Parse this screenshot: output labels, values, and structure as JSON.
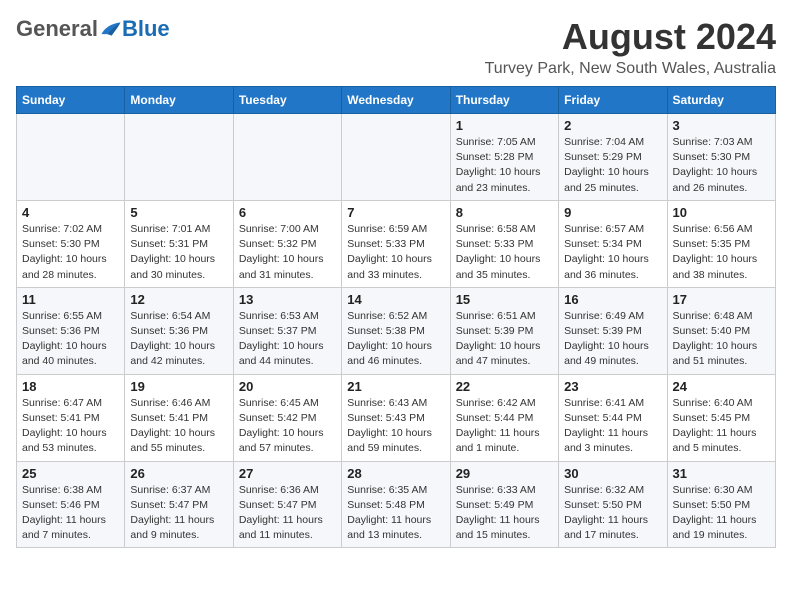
{
  "logo": {
    "general": "General",
    "blue": "Blue"
  },
  "title": "August 2024",
  "subtitle": "Turvey Park, New South Wales, Australia",
  "days_of_week": [
    "Sunday",
    "Monday",
    "Tuesday",
    "Wednesday",
    "Thursday",
    "Friday",
    "Saturday"
  ],
  "weeks": [
    [
      {
        "day": "",
        "info": ""
      },
      {
        "day": "",
        "info": ""
      },
      {
        "day": "",
        "info": ""
      },
      {
        "day": "",
        "info": ""
      },
      {
        "day": "1",
        "info": "Sunrise: 7:05 AM\nSunset: 5:28 PM\nDaylight: 10 hours\nand 23 minutes."
      },
      {
        "day": "2",
        "info": "Sunrise: 7:04 AM\nSunset: 5:29 PM\nDaylight: 10 hours\nand 25 minutes."
      },
      {
        "day": "3",
        "info": "Sunrise: 7:03 AM\nSunset: 5:30 PM\nDaylight: 10 hours\nand 26 minutes."
      }
    ],
    [
      {
        "day": "4",
        "info": "Sunrise: 7:02 AM\nSunset: 5:30 PM\nDaylight: 10 hours\nand 28 minutes."
      },
      {
        "day": "5",
        "info": "Sunrise: 7:01 AM\nSunset: 5:31 PM\nDaylight: 10 hours\nand 30 minutes."
      },
      {
        "day": "6",
        "info": "Sunrise: 7:00 AM\nSunset: 5:32 PM\nDaylight: 10 hours\nand 31 minutes."
      },
      {
        "day": "7",
        "info": "Sunrise: 6:59 AM\nSunset: 5:33 PM\nDaylight: 10 hours\nand 33 minutes."
      },
      {
        "day": "8",
        "info": "Sunrise: 6:58 AM\nSunset: 5:33 PM\nDaylight: 10 hours\nand 35 minutes."
      },
      {
        "day": "9",
        "info": "Sunrise: 6:57 AM\nSunset: 5:34 PM\nDaylight: 10 hours\nand 36 minutes."
      },
      {
        "day": "10",
        "info": "Sunrise: 6:56 AM\nSunset: 5:35 PM\nDaylight: 10 hours\nand 38 minutes."
      }
    ],
    [
      {
        "day": "11",
        "info": "Sunrise: 6:55 AM\nSunset: 5:36 PM\nDaylight: 10 hours\nand 40 minutes."
      },
      {
        "day": "12",
        "info": "Sunrise: 6:54 AM\nSunset: 5:36 PM\nDaylight: 10 hours\nand 42 minutes."
      },
      {
        "day": "13",
        "info": "Sunrise: 6:53 AM\nSunset: 5:37 PM\nDaylight: 10 hours\nand 44 minutes."
      },
      {
        "day": "14",
        "info": "Sunrise: 6:52 AM\nSunset: 5:38 PM\nDaylight: 10 hours\nand 46 minutes."
      },
      {
        "day": "15",
        "info": "Sunrise: 6:51 AM\nSunset: 5:39 PM\nDaylight: 10 hours\nand 47 minutes."
      },
      {
        "day": "16",
        "info": "Sunrise: 6:49 AM\nSunset: 5:39 PM\nDaylight: 10 hours\nand 49 minutes."
      },
      {
        "day": "17",
        "info": "Sunrise: 6:48 AM\nSunset: 5:40 PM\nDaylight: 10 hours\nand 51 minutes."
      }
    ],
    [
      {
        "day": "18",
        "info": "Sunrise: 6:47 AM\nSunset: 5:41 PM\nDaylight: 10 hours\nand 53 minutes."
      },
      {
        "day": "19",
        "info": "Sunrise: 6:46 AM\nSunset: 5:41 PM\nDaylight: 10 hours\nand 55 minutes."
      },
      {
        "day": "20",
        "info": "Sunrise: 6:45 AM\nSunset: 5:42 PM\nDaylight: 10 hours\nand 57 minutes."
      },
      {
        "day": "21",
        "info": "Sunrise: 6:43 AM\nSunset: 5:43 PM\nDaylight: 10 hours\nand 59 minutes."
      },
      {
        "day": "22",
        "info": "Sunrise: 6:42 AM\nSunset: 5:44 PM\nDaylight: 11 hours\nand 1 minute."
      },
      {
        "day": "23",
        "info": "Sunrise: 6:41 AM\nSunset: 5:44 PM\nDaylight: 11 hours\nand 3 minutes."
      },
      {
        "day": "24",
        "info": "Sunrise: 6:40 AM\nSunset: 5:45 PM\nDaylight: 11 hours\nand 5 minutes."
      }
    ],
    [
      {
        "day": "25",
        "info": "Sunrise: 6:38 AM\nSunset: 5:46 PM\nDaylight: 11 hours\nand 7 minutes."
      },
      {
        "day": "26",
        "info": "Sunrise: 6:37 AM\nSunset: 5:47 PM\nDaylight: 11 hours\nand 9 minutes."
      },
      {
        "day": "27",
        "info": "Sunrise: 6:36 AM\nSunset: 5:47 PM\nDaylight: 11 hours\nand 11 minutes."
      },
      {
        "day": "28",
        "info": "Sunrise: 6:35 AM\nSunset: 5:48 PM\nDaylight: 11 hours\nand 13 minutes."
      },
      {
        "day": "29",
        "info": "Sunrise: 6:33 AM\nSunset: 5:49 PM\nDaylight: 11 hours\nand 15 minutes."
      },
      {
        "day": "30",
        "info": "Sunrise: 6:32 AM\nSunset: 5:50 PM\nDaylight: 11 hours\nand 17 minutes."
      },
      {
        "day": "31",
        "info": "Sunrise: 6:30 AM\nSunset: 5:50 PM\nDaylight: 11 hours\nand 19 minutes."
      }
    ]
  ]
}
